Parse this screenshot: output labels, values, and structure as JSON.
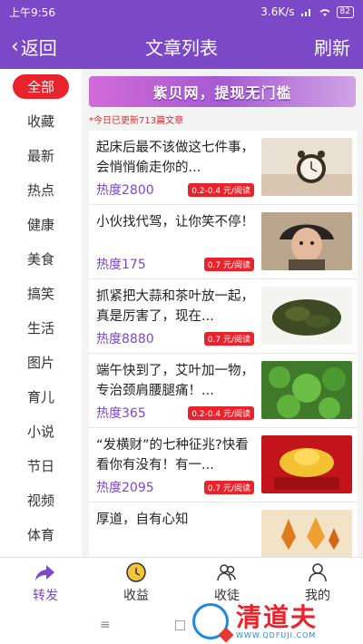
{
  "status": {
    "time": "上午9:56",
    "speed": "3.6K/s",
    "battery": "82"
  },
  "nav": {
    "back_label": "返回",
    "title": "文章列表",
    "refresh_label": "刷新"
  },
  "sidebar": {
    "items": [
      {
        "label": "全部",
        "active": true
      },
      {
        "label": "收藏"
      },
      {
        "label": "最新"
      },
      {
        "label": "热点"
      },
      {
        "label": "健康"
      },
      {
        "label": "美食"
      },
      {
        "label": "搞笑"
      },
      {
        "label": "生活"
      },
      {
        "label": "图片"
      },
      {
        "label": "育儿"
      },
      {
        "label": "小说"
      },
      {
        "label": "节日"
      },
      {
        "label": "视频"
      },
      {
        "label": "体育"
      }
    ]
  },
  "banner": {
    "text": "紫贝网，提现无门槛"
  },
  "update_note": "*今日已更新713篇文章",
  "articles": [
    {
      "title": "起床后最不该做这七件事，会悄悄偷走你的...",
      "heat": "热度2800",
      "rate": "0.2-0.4 元/阅读",
      "image": "alarm-clock-image"
    },
    {
      "title": "小伙找代驾，让你笑不停！",
      "heat": "热度175",
      "rate": "0.7 元/阅读",
      "image": "woman-portrait-image"
    },
    {
      "title": "抓紧把大蒜和茶叶放一起，真是厉害了，现在...",
      "heat": "热度8880",
      "rate": "0.7 元/阅读",
      "image": "tea-leaves-image"
    },
    {
      "title": "端午快到了，艾叶加一物，专治颈肩腰腿痛！...",
      "heat": "热度365",
      "rate": "0.2-0.4 元/阅读",
      "image": "mugwort-image"
    },
    {
      "title": "“发横财”的七种征兆?快看看你有没有！有一...",
      "heat": "热度2095",
      "rate": "0.7 元/阅读",
      "image": "gold-ingot-image"
    },
    {
      "title": "厚道，自有心知",
      "heat": "",
      "rate": "",
      "image": "autumn-leaves-image"
    }
  ],
  "tabs": [
    {
      "label": "转发",
      "icon": "share-icon",
      "active": true
    },
    {
      "label": "收益",
      "icon": "coin-icon"
    },
    {
      "label": "收徒",
      "icon": "users-icon"
    },
    {
      "label": "我的",
      "icon": "user-icon"
    }
  ],
  "system_nav": {
    "menu": "≡",
    "home": "□"
  },
  "watermark": {
    "text": "清道夫",
    "url": "WWW.QDFUJI.COM"
  },
  "colors": {
    "brand": "#7b48c8",
    "accent_red": "#e8232c"
  }
}
